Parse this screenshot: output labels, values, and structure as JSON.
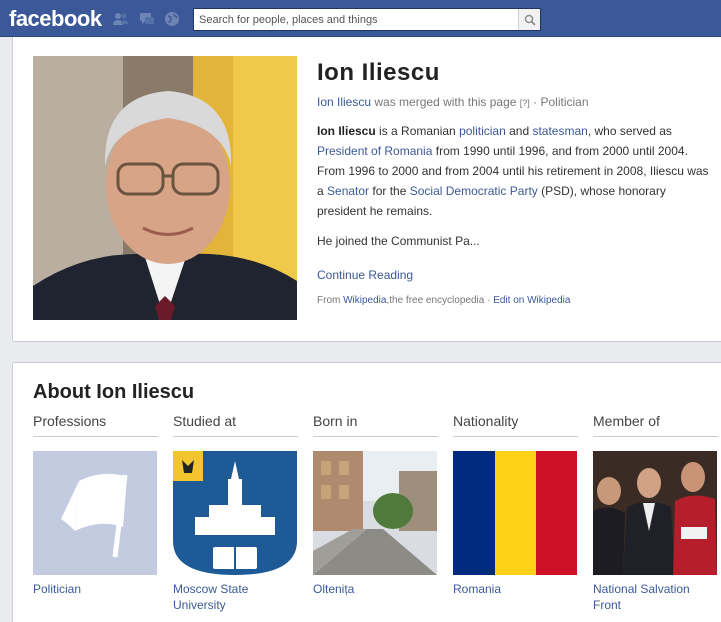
{
  "header": {
    "logo": "facebook",
    "search_placeholder": "Search for people, places and things"
  },
  "profile": {
    "name": "Ion Iliescu",
    "merged_name": "Ion Iliescu",
    "merged_text": "was merged with this page",
    "merged_help": "[?]",
    "category": "Politician",
    "bio": {
      "name": "Ion Iliescu",
      "t1": " is a Romanian ",
      "l1": "politician",
      "t2": " and ",
      "l2": "statesman",
      "t3": ", who served as ",
      "l3": "President of Romania",
      "t4": " from 1990 until 1996, and from 2000 until 2004. From 1996 to 2000 and from 2004 until his retirement in 2008, Iliescu was a ",
      "l4": "Senator",
      "t5": " for the ",
      "l5": "Social Democratic Party",
      "t6": " (PSD), whose honorary president he remains."
    },
    "bio_more": "He joined the Communist Pa...",
    "continue": "Continue Reading",
    "source_prefix": "From ",
    "source_link": "Wikipedia",
    "source_suffix": ",the free encyclopedia · ",
    "edit_link": "Edit on Wikipedia"
  },
  "about": {
    "title": "About Ion Iliescu",
    "columns": [
      {
        "heading": "Professions",
        "label": "Politician"
      },
      {
        "heading": "Studied at",
        "label": "Moscow State University"
      },
      {
        "heading": "Born in",
        "label": "Oltenița"
      },
      {
        "heading": "Nationality",
        "label": "Romania"
      },
      {
        "heading": "Member of",
        "label": "National Salvation Front"
      }
    ]
  },
  "colors": {
    "brand": "#3b5998",
    "flag_blue": "#002b7f",
    "flag_yellow": "#fcd116",
    "flag_red": "#ce1126"
  }
}
